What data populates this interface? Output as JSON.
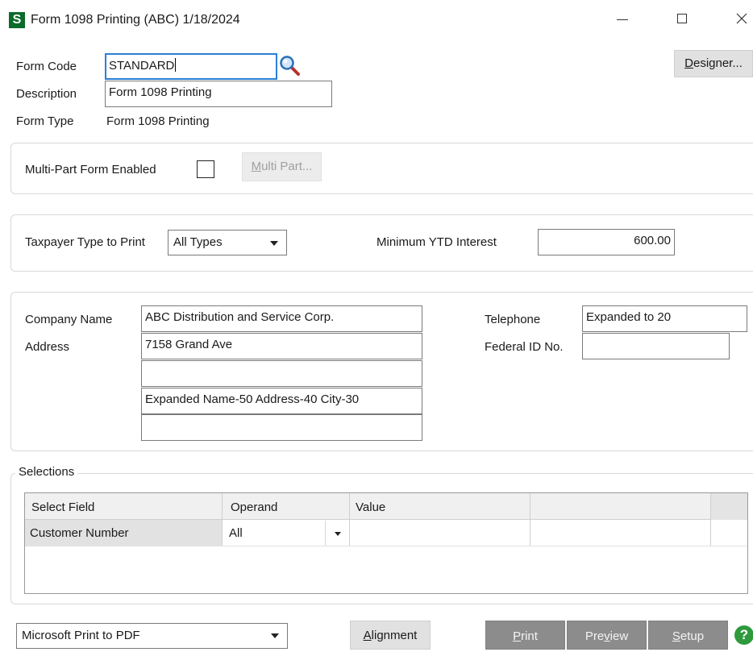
{
  "window": {
    "app_icon_letter": "S",
    "title": "Form 1098 Printing (ABC) 1/18/2024"
  },
  "header": {
    "form_code_label": "Form Code",
    "form_code_value": "STANDARD",
    "description_label": "Description",
    "description_value": "Form 1098 Printing",
    "form_type_label": "Form Type",
    "form_type_value": "Form 1098 Printing",
    "designer_label_ul": "D",
    "designer_label_rest": "esigner..."
  },
  "multipart": {
    "label": "Multi-Part Form Enabled",
    "checked": false,
    "button_ul": "M",
    "button_rest": "ulti Part..."
  },
  "taxpayer": {
    "type_label": "Taxpayer Type to Print",
    "type_value": "All Types",
    "min_ytd_label": "Minimum YTD Interest",
    "min_ytd_value": "600.00"
  },
  "company": {
    "name_label": "Company Name",
    "name_value": "ABC Distribution and Service Corp.",
    "address_label": "Address",
    "address_lines": [
      "7158 Grand Ave",
      "",
      "Expanded Name-50 Address-40 City-30",
      ""
    ],
    "telephone_label": "Telephone",
    "telephone_value": "Expanded to 20",
    "federal_id_label": "Federal ID No.",
    "federal_id_value": ""
  },
  "selections": {
    "title": "Selections",
    "columns": [
      "Select Field",
      "Operand",
      "Value",
      ""
    ],
    "rows": [
      {
        "field": "Customer Number",
        "operand": "All",
        "value": "",
        "extra": ""
      }
    ]
  },
  "footer": {
    "printer_value": "Microsoft Print to PDF",
    "alignment_ul": "A",
    "alignment_rest": "lignment",
    "print_ul": "P",
    "print_rest": "rint",
    "preview_pre": "Pre",
    "preview_ul": "v",
    "preview_rest": "iew",
    "setup_ul": "S",
    "setup_rest": "etup",
    "help_glyph": "?"
  },
  "colors": {
    "app_icon_bg": "#0b6b2b",
    "focus_border": "#2a7fd4",
    "help_icon": "#2e9a3c",
    "dark_button": "#8c8c8c"
  }
}
